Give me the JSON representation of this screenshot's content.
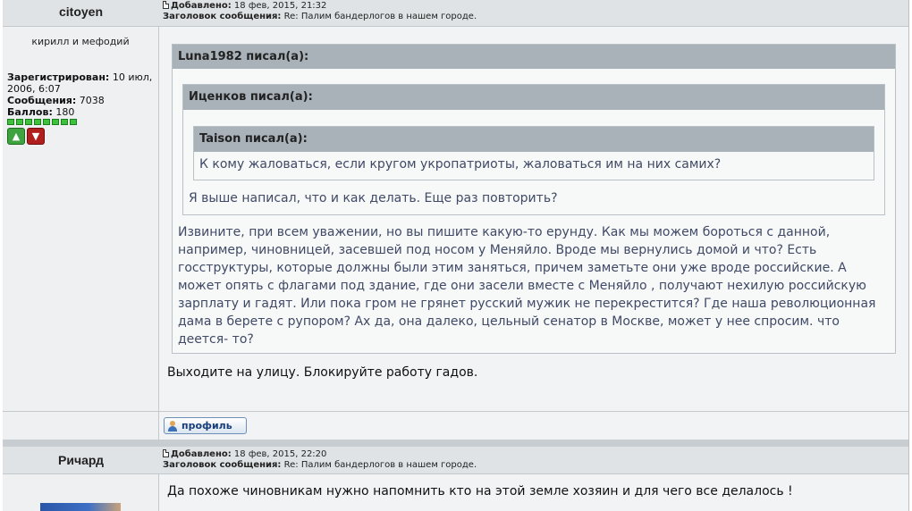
{
  "post1": {
    "author": "citoyen",
    "added_label": "Добавлено:",
    "added_value": "18 фев, 2015, 21:32",
    "subject_label": "Заголовок сообщения:",
    "subject_value": "Re: Палим бандерлогов в нашем городе.",
    "rank": "кирилл и мефодий",
    "registered_label": "Зарегистрирован:",
    "registered_value": "10 июл, 2006, 6:07",
    "posts_label": "Сообщения:",
    "posts_value": "7038",
    "points_label": "Баллов:",
    "points_value": "180",
    "rating_pips": 8,
    "quote_outer": {
      "header": "Luna1982 писал(а):",
      "text": "Извините, при всем уважении, но вы пишите какую-то ерунду. Как мы можем бороться с данной, например, чиновницей, засевшей под носом у Меняйло. Вроде мы вернулись домой и что? Есть госструктуры, которые должны были этим заняться, причем заметьте они уже вроде российские. А может опять с флагами под здание, где они засели вместе с Меняйло , получают нехилую российскую зарплату и гадят. Или пока гром не грянет русский мужик не перекрестится? Где наша революционная дама в берете с рупором? Ах да, она далеко, цельный сенатор в Москве, может у нее спросим. что деется- то?"
    },
    "quote_middle": {
      "header": "Иценков писал(а):",
      "text": "Я выше написал, что и как делать. Еще раз повторить?"
    },
    "quote_inner": {
      "header": "Taison писал(а):",
      "text": "К кому жаловаться, если кругом укропатриоты, жаловаться им на них самих?"
    },
    "message": "Выходите на улицу. Блокируйте работу гадов.",
    "profile_button": "профиль"
  },
  "post2": {
    "author": "Ричард",
    "added_label": "Добавлено:",
    "added_value": "18 фев, 2015, 22:20",
    "subject_label": "Заголовок сообщения:",
    "subject_value": "Re: Палим бандерлогов в нашем городе.",
    "message": "Да похоже чиновникам нужно напомнить кто на этой земле хозяин и для чего все делалось !"
  },
  "colors": {
    "quote_header_bg": "#a9b2b9",
    "quote_text": "#404a66",
    "rating_green": "#3ec23e",
    "vote_up": "#3fa33f",
    "vote_down": "#b01e1e"
  }
}
